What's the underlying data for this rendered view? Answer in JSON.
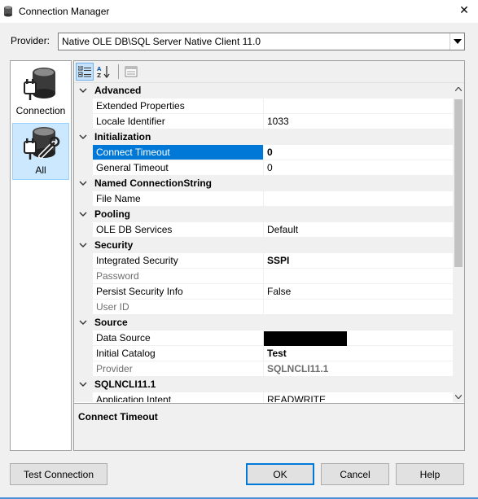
{
  "window": {
    "title": "Connection Manager",
    "close_glyph": "✕"
  },
  "provider": {
    "label": "Provider:",
    "value": "Native OLE DB\\SQL Server Native Client 11.0"
  },
  "nav": {
    "items": [
      {
        "label": "Connection",
        "icon": "database-plug-icon",
        "selected": false
      },
      {
        "label": "All",
        "icon": "database-plug-wrench-icon",
        "selected": true
      }
    ]
  },
  "toolbar": {
    "buttons": [
      "categorized-icon",
      "alphabetical-icon",
      "property-pages-icon"
    ]
  },
  "grid": {
    "categories": [
      {
        "name": "Advanced",
        "props": [
          {
            "name": "Extended Properties",
            "value": ""
          },
          {
            "name": "Locale Identifier",
            "value": "1033"
          }
        ]
      },
      {
        "name": "Initialization",
        "props": [
          {
            "name": "Connect Timeout",
            "value": "0",
            "selected": true,
            "bold": true
          },
          {
            "name": "General Timeout",
            "value": "0"
          }
        ]
      },
      {
        "name": "Named ConnectionString",
        "props": [
          {
            "name": "File Name",
            "value": ""
          }
        ]
      },
      {
        "name": "Pooling",
        "props": [
          {
            "name": "OLE DB Services",
            "value": "Default"
          }
        ]
      },
      {
        "name": "Security",
        "props": [
          {
            "name": "Integrated Security",
            "value": "SSPI",
            "bold": true
          },
          {
            "name": "Password",
            "value": "",
            "dim": true
          },
          {
            "name": "Persist Security Info",
            "value": "False"
          },
          {
            "name": "User ID",
            "value": "",
            "dim": true
          }
        ]
      },
      {
        "name": "Source",
        "props": [
          {
            "name": "Data Source",
            "value": "",
            "redacted": true
          },
          {
            "name": "Initial Catalog",
            "value": "Test",
            "bold": true
          },
          {
            "name": "Provider",
            "value": "SQLNCLI11.1",
            "dim": true,
            "bold": true
          }
        ]
      },
      {
        "name": "SQLNCLI11.1",
        "props": [
          {
            "name": "Application Intent",
            "value": "READWRITE"
          }
        ]
      }
    ]
  },
  "description": {
    "title": "Connect Timeout"
  },
  "buttons": {
    "test_connection": "Test Connection",
    "ok": "OK",
    "cancel": "Cancel",
    "help": "Help"
  },
  "colors": {
    "selection": "#0078d7",
    "nav_selected": "#cce8ff"
  }
}
